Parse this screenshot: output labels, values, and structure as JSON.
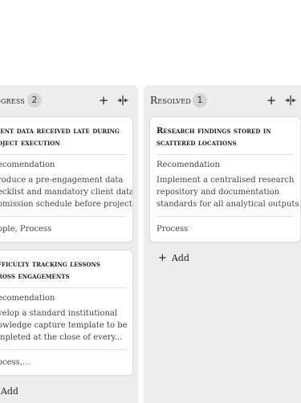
{
  "columns": {
    "in_progress": {
      "title": "rogress",
      "count": "2",
      "cards": [
        {
          "title_lines": [
            "ient data received late during",
            "oject execution"
          ],
          "label": "ecomendation",
          "body_lines": [
            "roduce a pre-engagement data",
            "ecklist and mandatory client data",
            "omission schedule before project..."
          ],
          "tags": "ople, Process"
        },
        {
          "title_lines": [
            "fficulty tracking lessons",
            "ross engagements"
          ],
          "label": "ecomendation",
          "body_lines": [
            "velop a standard institutional",
            "owledge capture template to be",
            "mpleted at the close of every..."
          ],
          "tags": "ocess,..."
        }
      ],
      "add_label": "Add"
    },
    "resolved": {
      "title": "Resolved",
      "count": "1",
      "cards": [
        {
          "title_lines": [
            "Research findings stored in",
            "scattered locations"
          ],
          "label": "Recomendation",
          "body_lines": [
            "Implement a centralised research",
            "repository and documentation",
            "standards for all analytical outputs."
          ],
          "tags": "Process"
        }
      ],
      "add_label": "Add"
    }
  },
  "icons": {
    "add": "plus-icon",
    "collapse": "collapse-column-icon"
  }
}
